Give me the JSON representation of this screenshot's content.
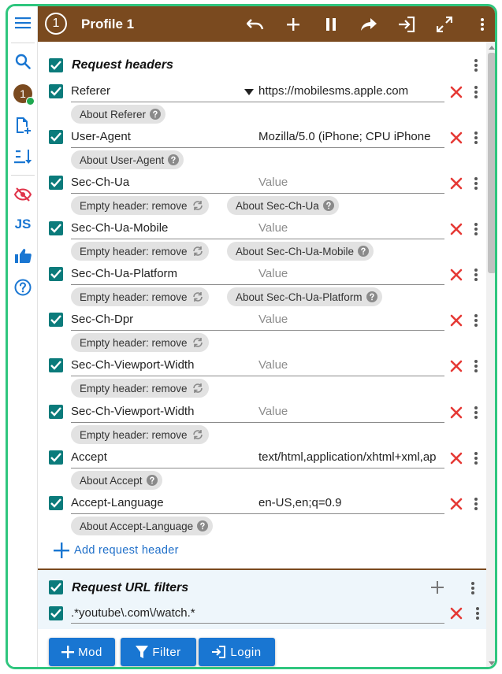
{
  "colors": {
    "accent": "#2fc67e",
    "header_bg": "#7a4a1f",
    "checkbox": "#0b7b7b",
    "primary": "#1976d2",
    "delete": "#e53935"
  },
  "sidebar": {
    "badge": "1"
  },
  "topbar": {
    "profile_number": "1",
    "profile_name": "Profile 1"
  },
  "request_headers": {
    "title": "Request headers",
    "items": [
      {
        "name": "Referer",
        "value": "https://mobilesms.apple.com",
        "placeholder": false,
        "chips": [
          "About Referer"
        ]
      },
      {
        "name": "User-Agent",
        "value": "Mozilla/5.0 (iPhone; CPU iPhone",
        "placeholder": false,
        "chips": [
          "About User-Agent"
        ]
      },
      {
        "name": "Sec-Ch-Ua",
        "value": "Value",
        "placeholder": true,
        "chips": [
          "Empty header: remove",
          "About Sec-Ch-Ua"
        ]
      },
      {
        "name": "Sec-Ch-Ua-Mobile",
        "value": "Value",
        "placeholder": true,
        "chips": [
          "Empty header: remove",
          "About Sec-Ch-Ua-Mobile"
        ]
      },
      {
        "name": "Sec-Ch-Ua-Platform",
        "value": "Value",
        "placeholder": true,
        "chips": [
          "Empty header: remove",
          "About Sec-Ch-Ua-Platform"
        ]
      },
      {
        "name": "Sec-Ch-Dpr",
        "value": "Value",
        "placeholder": true,
        "chips": [
          "Empty header: remove"
        ]
      },
      {
        "name": "Sec-Ch-Viewport-Width",
        "value": "Value",
        "placeholder": true,
        "chips": [
          "Empty header: remove"
        ]
      },
      {
        "name": "Sec-Ch-Viewport-Width",
        "value": "Value",
        "placeholder": true,
        "chips": [
          "Empty header: remove"
        ]
      },
      {
        "name": "Accept",
        "value": "text/html,application/xhtml+xml,ap",
        "placeholder": false,
        "chips": [
          "About Accept"
        ]
      },
      {
        "name": "Accept-Language",
        "value": "en-US,en;q=0.9",
        "placeholder": false,
        "chips": [
          "About Accept-Language"
        ]
      }
    ],
    "add_label": "Add request header"
  },
  "url_filters": {
    "title": "Request URL filters",
    "items": [
      ".*youtube\\.com\\/watch.*"
    ]
  },
  "buttons": {
    "mod": "Mod",
    "filter": "Filter",
    "login": "Login"
  }
}
